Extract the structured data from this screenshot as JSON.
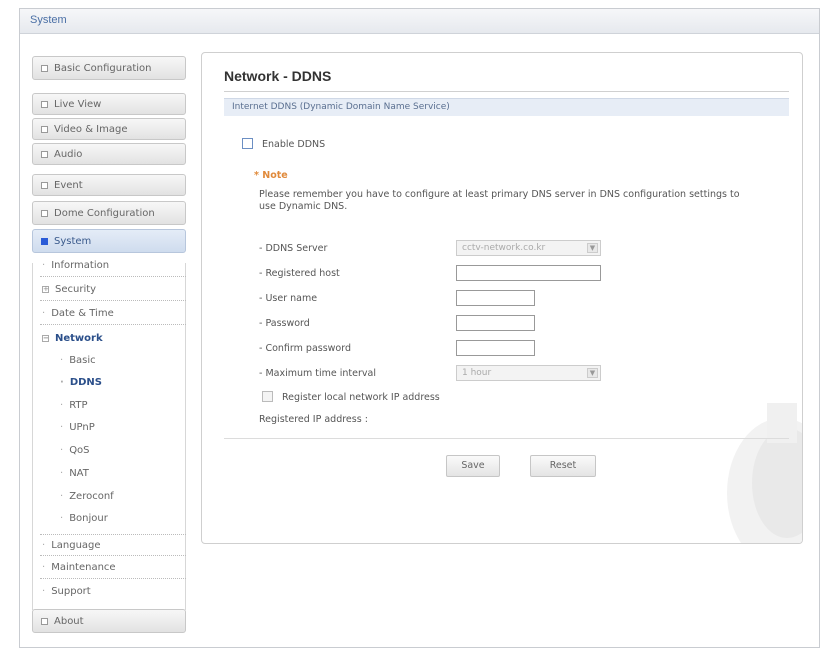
{
  "window": {
    "title": "System"
  },
  "sidebar": {
    "basic_configuration": "Basic Configuration",
    "live_view": "Live View",
    "video_image": "Video & Image",
    "audio": "Audio",
    "event": "Event",
    "dome_configuration": "Dome Configuration",
    "system": "System",
    "system_items": {
      "information": "Information",
      "security": "Security",
      "date_time": "Date & Time",
      "network": "Network",
      "network_items": [
        "Basic",
        "DDNS",
        "RTP",
        "UPnP",
        "QoS",
        "NAT",
        "Zeroconf",
        "Bonjour"
      ],
      "language": "Language",
      "maintenance": "Maintenance",
      "support": "Support"
    },
    "about": "About"
  },
  "main": {
    "title": "Network - DDNS",
    "section": "Internet DDNS (Dynamic Domain Name Service)",
    "enable_label": "Enable DDNS",
    "note_title": "* Note",
    "note_text": "Please remember you have to configure at least primary DNS server in DNS configuration settings to use Dynamic DNS.",
    "fields": {
      "ddns_server_label": "- DDNS Server",
      "ddns_server_value": "cctv-network.co.kr",
      "registered_host_label": "- Registered host",
      "user_name_label": "- User name",
      "password_label": "- Password",
      "confirm_password_label": "- Confirm password",
      "max_interval_label": "- Maximum time interval",
      "max_interval_value": "1 hour",
      "register_local_label": "Register local network IP address",
      "registered_ip_label": "Registered IP address :"
    },
    "buttons": {
      "save": "Save",
      "reset": "Reset"
    }
  }
}
